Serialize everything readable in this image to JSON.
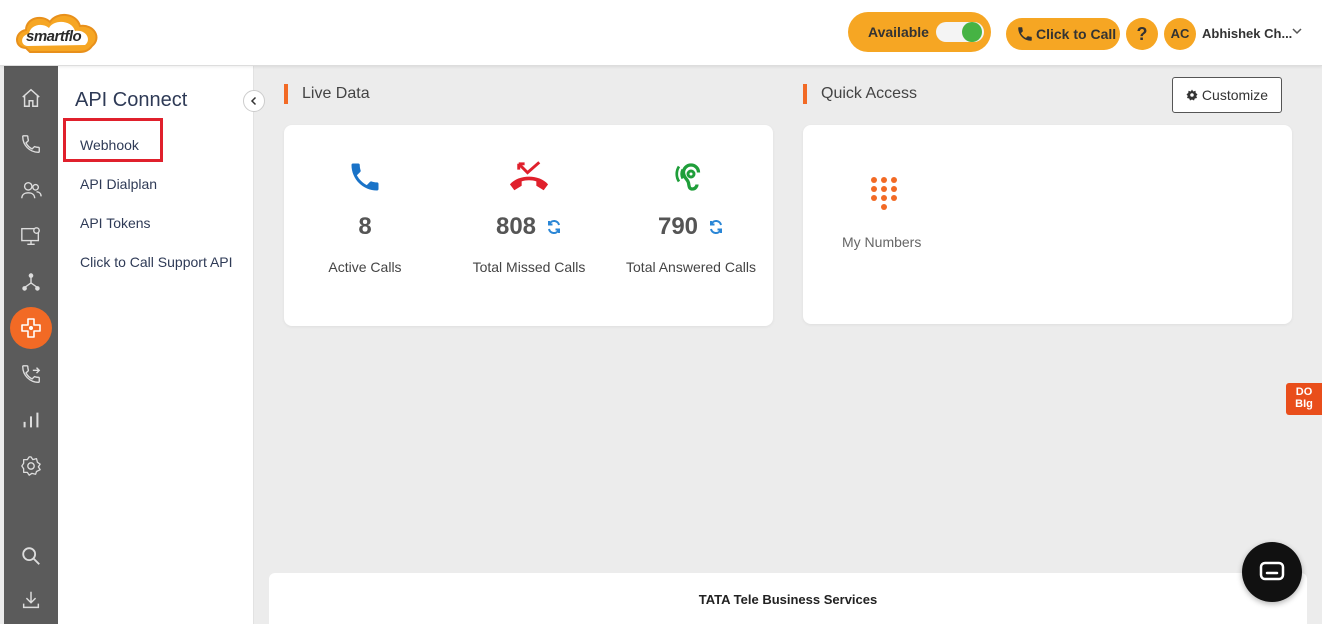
{
  "header": {
    "logo_text": "smartflo",
    "status_label": "Available",
    "status_on": true,
    "click_to_call_label": "Click to Call",
    "help_label": "?",
    "avatar_initials": "AC",
    "username": "Abhishek Ch..."
  },
  "rail": {
    "items": [
      "home-icon",
      "phone-icon",
      "users-icon",
      "monitor-settings-icon",
      "network-icon",
      "api-connect-icon",
      "call-transfer-icon",
      "analytics-icon",
      "settings-icon",
      "search-icon",
      "download-icon"
    ],
    "active": "api-connect-icon"
  },
  "subnav": {
    "title": "API Connect",
    "items": [
      {
        "label": "Webhook"
      },
      {
        "label": "API Dialplan"
      },
      {
        "label": "API Tokens"
      },
      {
        "label": "Click to Call Support API"
      }
    ]
  },
  "live_data": {
    "title": "Live Data",
    "stats": [
      {
        "value": "8",
        "label": "Active Calls",
        "icon": "phone-icon",
        "color": "#1a73c8"
      },
      {
        "value": "808",
        "label": "Total Missed Calls",
        "icon": "missed-call-icon",
        "color": "#e0202c"
      },
      {
        "value": "790",
        "label": "Total Answered Calls",
        "icon": "ear-icon",
        "color": "#1f9e3a"
      }
    ]
  },
  "quick_access": {
    "title": "Quick Access",
    "customize_label": "Customize",
    "items": [
      {
        "label": "My Numbers",
        "icon": "dialpad-icon"
      }
    ]
  },
  "side_badge": {
    "line1": "DO",
    "line2": "BIg"
  },
  "footer": {
    "text": "TATA Tele Business Services"
  },
  "colors": {
    "accent": "#f26a25",
    "status": "#f6a623"
  }
}
